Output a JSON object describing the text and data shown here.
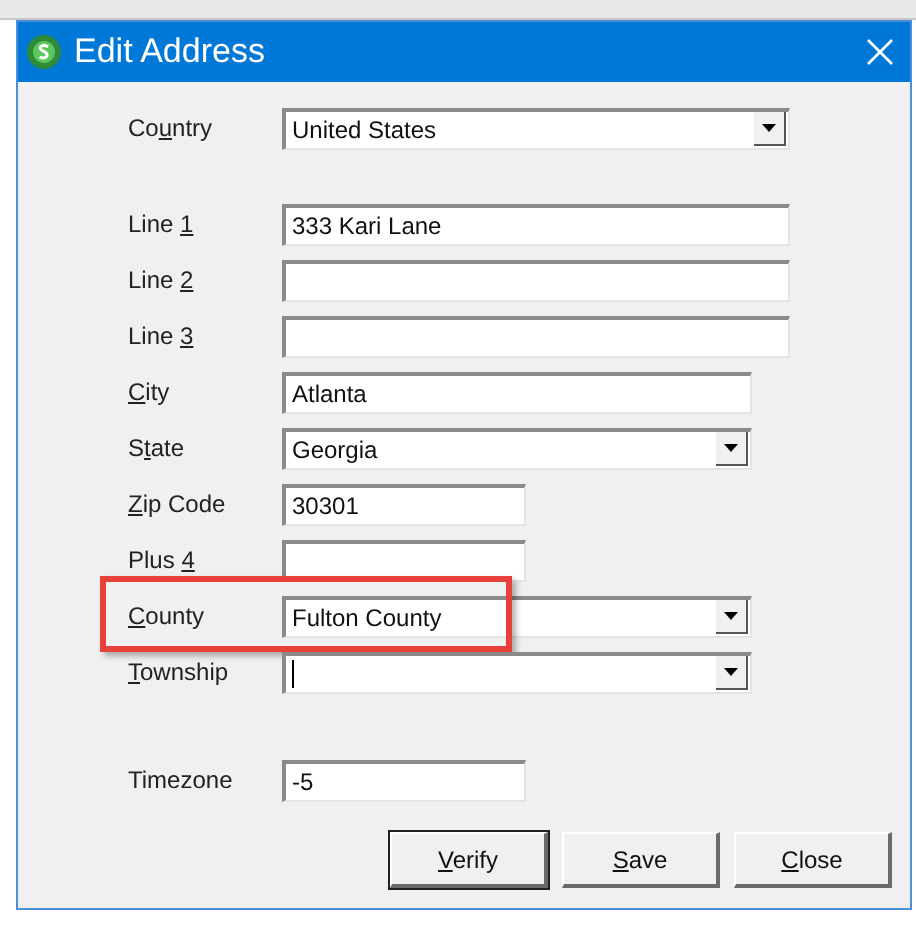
{
  "window": {
    "title": "Edit Address"
  },
  "sections": [
    [
      {
        "label_pre": "Co",
        "access_key": "u",
        "label_post": "ntry",
        "kind": "dropdown",
        "value": "United States",
        "focused": false,
        "highlighted": false
      }
    ],
    [
      {
        "label_pre": "Line ",
        "access_key": "1",
        "kind": "text",
        "value": "333 Kari Lane",
        "focused": false,
        "highlighted": false
      },
      {
        "label_pre": "Line ",
        "access_key": "2",
        "kind": "text",
        "focused": false,
        "highlighted": false
      },
      {
        "label_pre": "Line ",
        "access_key": "3",
        "kind": "text",
        "focused": false,
        "highlighted": false
      },
      {
        "access_key": "C",
        "label_post": "ity",
        "kind": "text",
        "value": "Atlanta",
        "focused": false,
        "highlighted": false
      },
      {
        "label_pre": "S",
        "access_key": "t",
        "label_post": "ate",
        "kind": "dropdown",
        "value": "Georgia",
        "focused": false,
        "highlighted": false
      },
      {
        "access_key": "Z",
        "label_post": "ip Code",
        "kind": "text",
        "value": "30301",
        "focused": false,
        "highlighted": false
      },
      {
        "label_pre": "Plus ",
        "access_key": "4",
        "kind": "text",
        "focused": false,
        "highlighted": false
      },
      {
        "access_key": "C",
        "label_post": "ounty",
        "kind": "dropdown",
        "value": "Fulton County",
        "focused": false,
        "highlighted": true
      },
      {
        "access_key": "T",
        "label_post": "ownship",
        "kind": "dropdown",
        "focused": true,
        "highlighted": false
      }
    ],
    [
      {
        "label_pre": "Timezone",
        "kind": "text",
        "value": "-5",
        "focused": false,
        "highlighted": false
      }
    ]
  ],
  "buttons": [
    {
      "access_key": "V",
      "label_post": "erify",
      "default": true
    },
    {
      "access_key": "S",
      "label_post": "ave",
      "default": false
    },
    {
      "access_key": "C",
      "label_post": "lose",
      "default": false
    }
  ]
}
